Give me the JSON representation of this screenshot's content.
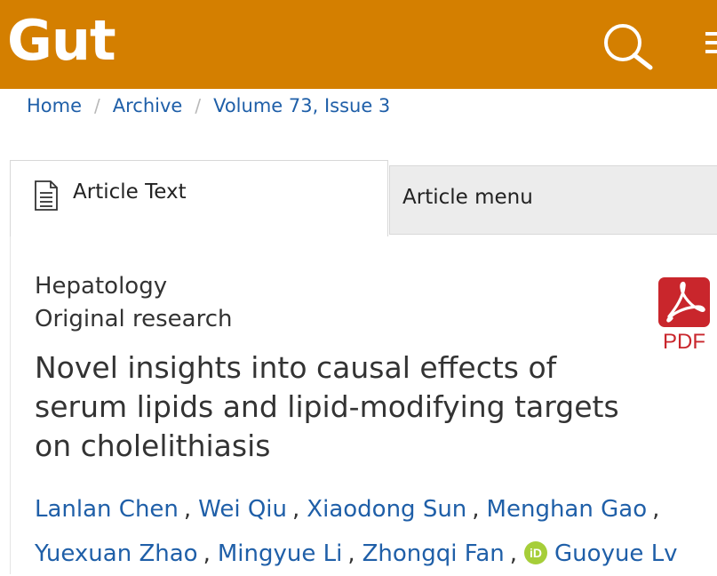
{
  "header": {
    "logo": "Gut",
    "brand_color": "#d47f00"
  },
  "breadcrumb": {
    "items": [
      "Home",
      "Archive",
      "Volume 73, Issue 3"
    ],
    "separator": "/"
  },
  "tabs": {
    "article_text": "Article Text",
    "article_menu": "Article menu"
  },
  "article": {
    "section": "Hepatology",
    "type": "Original research",
    "title": "Novel insights into causal effects of serum lipids and lipid-modifying targets on cholelithiasis",
    "pdf_label": "PDF",
    "authors": [
      "Lanlan Chen",
      "Wei Qiu",
      "Xiaodong Sun",
      "Menghan Gao",
      "Yuexuan Zhao",
      "Mingyue Li",
      "Zhongqi Fan",
      "Guoyue Lv"
    ],
    "orcid_label": "iD",
    "comma": ","
  },
  "icons": {
    "search": "search-icon",
    "menu": "hamburger-menu-icon",
    "document": "document-icon",
    "pdf": "pdf-icon",
    "orcid": "orcid-icon"
  }
}
